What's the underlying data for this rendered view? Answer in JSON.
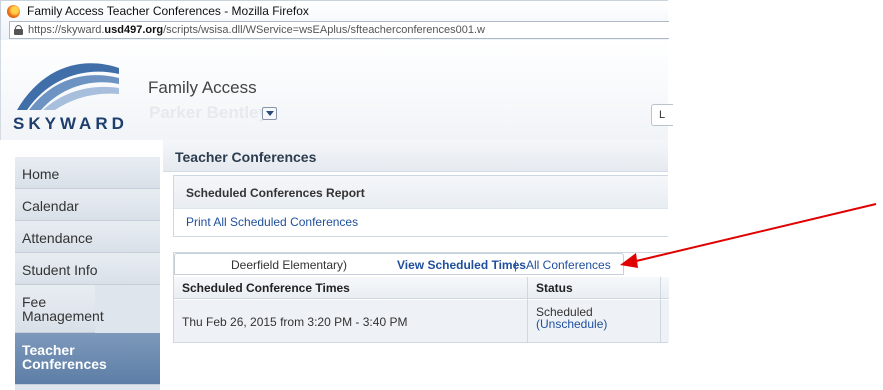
{
  "window": {
    "title": "Family Access Teacher Conferences - Mozilla Firefox",
    "url_prefix": "https://skyward.",
    "url_domain": "usd497.org",
    "url_suffix": "/scripts/wsisa.dll/WService=wsEAplus/sfteacherconferences001.w"
  },
  "header": {
    "logo_text": "SKYWARD",
    "app_title": "Family Access",
    "student_name": "Parker Bentley",
    "logout_stub": "L"
  },
  "sidebar": {
    "items": [
      {
        "label": "Home"
      },
      {
        "label": "Calendar"
      },
      {
        "label": "Attendance"
      },
      {
        "label": "Student Info"
      },
      {
        "label": "Fee Management"
      },
      {
        "label": "Teacher Conferences"
      }
    ]
  },
  "main": {
    "page_title": "Teacher Conferences",
    "report": {
      "heading": "Scheduled Conferences Report",
      "link": "Print All Scheduled Conferences"
    },
    "conferences": {
      "school": "Deerfield Elementary)",
      "view_times": "View Scheduled Times",
      "separator": "|",
      "all_conferences": "All Conferences",
      "columns": [
        "Scheduled Conference Times",
        "Status"
      ],
      "rows": [
        {
          "time": "Thu Feb 26, 2015 from 3:20 PM - 3:40 PM",
          "status": "Scheduled",
          "action": "(Unschedule)"
        }
      ]
    }
  },
  "colors": {
    "link": "#1f4f9c",
    "active_nav": "#5d7ea6",
    "annotation_arrow": "#e00000"
  }
}
